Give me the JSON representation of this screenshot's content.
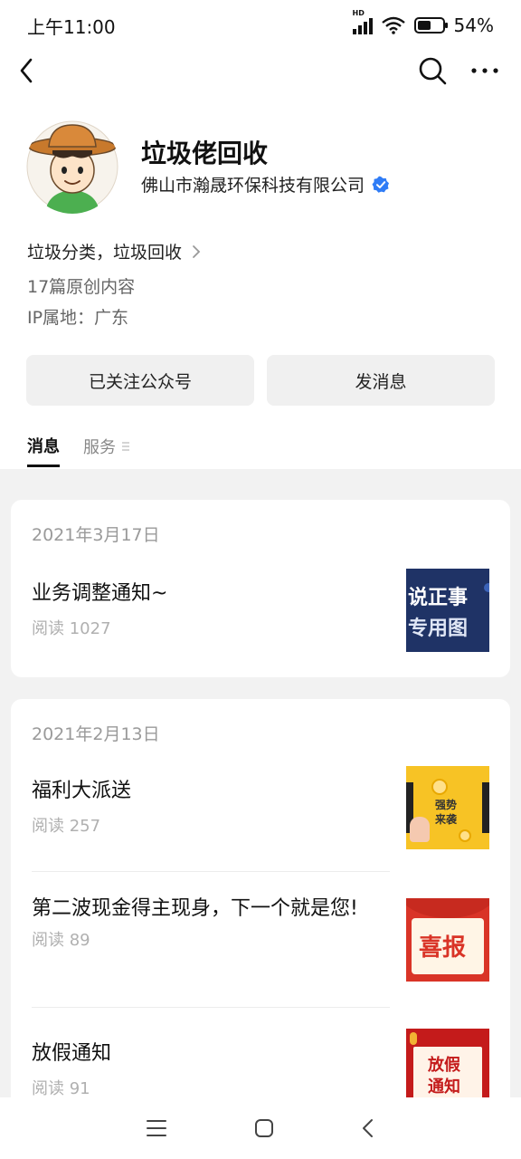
{
  "status_bar": {
    "time": "上午11:00",
    "hd": "HD",
    "battery_percent": "54%",
    "battery_level": 0.54
  },
  "nav": {
    "back": "back-icon",
    "search": "search-icon",
    "more": "more-icon"
  },
  "profile": {
    "name": "垃圾佬回收",
    "company": "佛山市瀚晟环保科技有限公司",
    "description": "垃圾分类，垃圾回收",
    "original_count": "17篇原创内容",
    "ip_location": "IP属地：广东"
  },
  "buttons": {
    "follow": "已关注公众号",
    "message": "发消息"
  },
  "tabs": [
    {
      "label": "消息",
      "active": true
    },
    {
      "label": "服务",
      "active": false
    }
  ],
  "cards": [
    {
      "date": "2021年3月17日",
      "articles": [
        {
          "title": "业务调整通知~",
          "reads": "阅读 1027",
          "thumb_text": [
            "说正事",
            "专用图"
          ]
        }
      ]
    },
    {
      "date": "2021年2月13日",
      "articles": [
        {
          "title": "福利大派送",
          "reads": "阅读 257",
          "thumb_text": [
            "强势",
            "来袭"
          ]
        },
        {
          "title": "第二波现金得主现身，下一个就是您!",
          "reads": "阅读 89",
          "thumb_text": [
            "喜报"
          ]
        },
        {
          "title": "放假通知",
          "reads": "阅读 91",
          "thumb_text": [
            "放假",
            "通知"
          ]
        }
      ]
    }
  ],
  "colors": {
    "verified": "#2f7cf6",
    "feed_bg": "#f2f2f2",
    "button_bg": "#f0f0f0"
  }
}
